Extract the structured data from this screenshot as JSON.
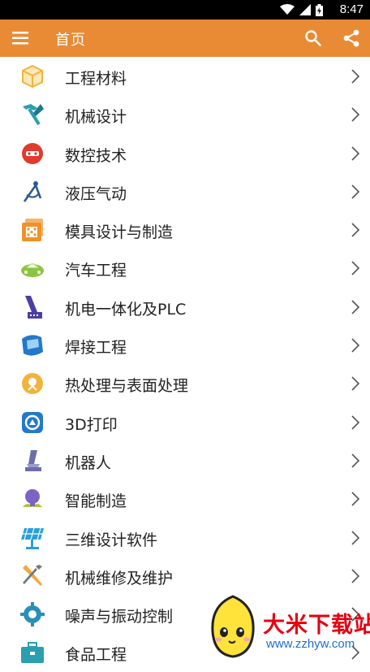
{
  "status_bar": {
    "time": "8:47"
  },
  "app_bar": {
    "title": "首页",
    "bg_color": "#e98a35"
  },
  "categories": [
    {
      "label": "工程材料",
      "icon": "cube-icon",
      "color": "#f2b33d"
    },
    {
      "label": "机械设计",
      "icon": "hammer-icon",
      "color": "#2a9fb0"
    },
    {
      "label": "数控技术",
      "icon": "cnc-icon",
      "color": "#e23a2c"
    },
    {
      "label": "液压气动",
      "icon": "compass-icon",
      "color": "#2c5c8f"
    },
    {
      "label": "模具设计与制造",
      "icon": "mold-icon",
      "color": "#f29127"
    },
    {
      "label": "汽车工程",
      "icon": "car-icon",
      "color": "#8cc43f"
    },
    {
      "label": "机电一体化及PLC",
      "icon": "machine-icon",
      "color": "#4b3fa3"
    },
    {
      "label": "焊接工程",
      "icon": "welding-mask-icon",
      "color": "#2279c9"
    },
    {
      "label": "热处理与表面处理",
      "icon": "sun-badge-icon",
      "color": "#f2b33d"
    },
    {
      "label": "3D打印",
      "icon": "printer-3d-icon",
      "color": "#2279c9"
    },
    {
      "label": "机器人",
      "icon": "robot-arm-icon",
      "color": "#6b6fa8"
    },
    {
      "label": "智能制造",
      "icon": "bulb-icon",
      "color": "#7b63c4"
    },
    {
      "label": "三维设计软件",
      "icon": "solar-panel-icon",
      "color": "#2a9fd8"
    },
    {
      "label": "机械维修及维护",
      "icon": "wrench-screwdriver-icon",
      "color": "#f2a93a"
    },
    {
      "label": "噪声与振动控制",
      "icon": "gear-icon",
      "color": "#2a8fb8"
    },
    {
      "label": "食品工程",
      "icon": "toolbox-icon",
      "color": "#2a9fb0"
    }
  ],
  "watermark": {
    "brand": "大米下载站",
    "url": "www.zzhyw.com"
  }
}
